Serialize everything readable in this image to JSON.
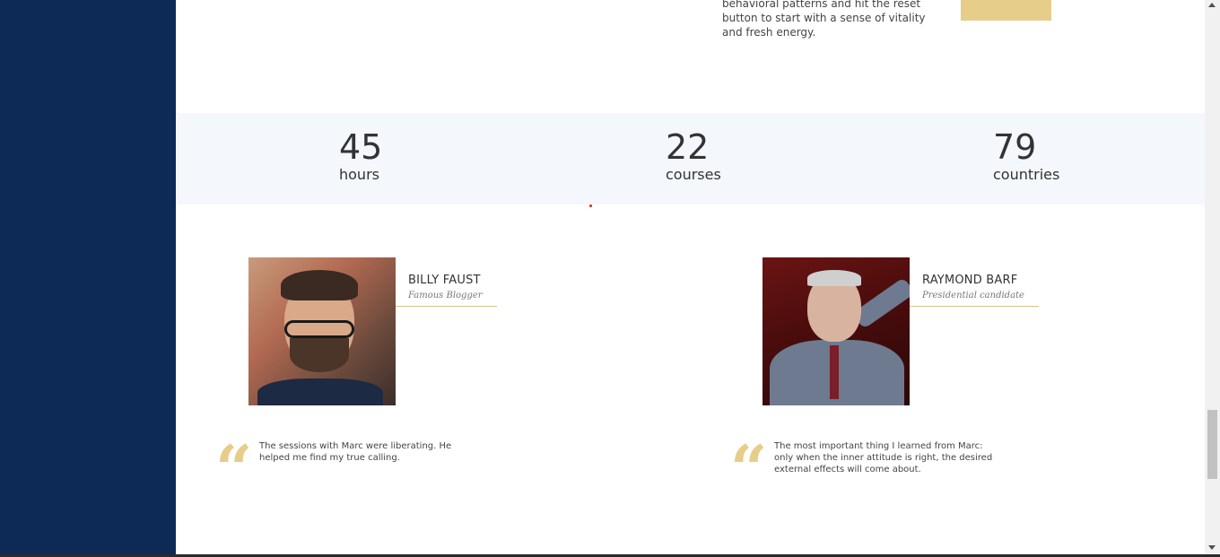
{
  "intro": {
    "text": "behavioral patterns and hit the reset button to start with a sense of vitality and fresh energy."
  },
  "stats": [
    {
      "number": "45",
      "label": "hours"
    },
    {
      "number": "22",
      "label": "courses"
    },
    {
      "number": "79",
      "label": "countries"
    }
  ],
  "testimonials": [
    {
      "name": "BILLY FAUST",
      "role": "Famous Blogger",
      "quote": "The sessions with Marc were liberating. He helped me find my true calling."
    },
    {
      "name": "RAYMOND BARF",
      "role": "Presidential candidate",
      "quote": "The most important thing I learned from Marc: only when the inner attitude is right, the desired external effects will come about."
    }
  ],
  "icons": {
    "quote": "quote-icon",
    "scroll_up": "chevron-up-icon",
    "scroll_down": "chevron-down-icon"
  },
  "colors": {
    "sidebar": "#0c2a55",
    "accent_gold": "#e6cd8a",
    "stats_bg": "#f4f7fc"
  }
}
